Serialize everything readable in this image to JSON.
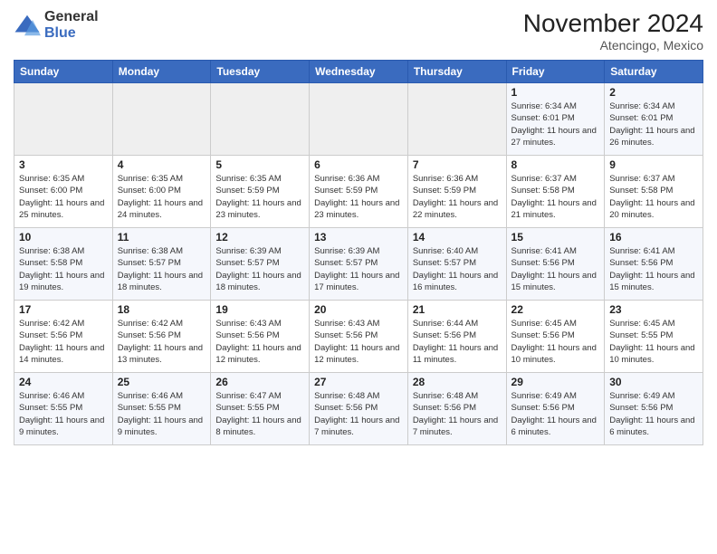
{
  "header": {
    "logo_general": "General",
    "logo_blue": "Blue",
    "month_title": "November 2024",
    "location": "Atencingo, Mexico"
  },
  "columns": [
    "Sunday",
    "Monday",
    "Tuesday",
    "Wednesday",
    "Thursday",
    "Friday",
    "Saturday"
  ],
  "weeks": [
    [
      {
        "day": "",
        "info": ""
      },
      {
        "day": "",
        "info": ""
      },
      {
        "day": "",
        "info": ""
      },
      {
        "day": "",
        "info": ""
      },
      {
        "day": "",
        "info": ""
      },
      {
        "day": "1",
        "info": "Sunrise: 6:34 AM\nSunset: 6:01 PM\nDaylight: 11 hours and 27 minutes."
      },
      {
        "day": "2",
        "info": "Sunrise: 6:34 AM\nSunset: 6:01 PM\nDaylight: 11 hours and 26 minutes."
      }
    ],
    [
      {
        "day": "3",
        "info": "Sunrise: 6:35 AM\nSunset: 6:00 PM\nDaylight: 11 hours and 25 minutes."
      },
      {
        "day": "4",
        "info": "Sunrise: 6:35 AM\nSunset: 6:00 PM\nDaylight: 11 hours and 24 minutes."
      },
      {
        "day": "5",
        "info": "Sunrise: 6:35 AM\nSunset: 5:59 PM\nDaylight: 11 hours and 23 minutes."
      },
      {
        "day": "6",
        "info": "Sunrise: 6:36 AM\nSunset: 5:59 PM\nDaylight: 11 hours and 23 minutes."
      },
      {
        "day": "7",
        "info": "Sunrise: 6:36 AM\nSunset: 5:59 PM\nDaylight: 11 hours and 22 minutes."
      },
      {
        "day": "8",
        "info": "Sunrise: 6:37 AM\nSunset: 5:58 PM\nDaylight: 11 hours and 21 minutes."
      },
      {
        "day": "9",
        "info": "Sunrise: 6:37 AM\nSunset: 5:58 PM\nDaylight: 11 hours and 20 minutes."
      }
    ],
    [
      {
        "day": "10",
        "info": "Sunrise: 6:38 AM\nSunset: 5:58 PM\nDaylight: 11 hours and 19 minutes."
      },
      {
        "day": "11",
        "info": "Sunrise: 6:38 AM\nSunset: 5:57 PM\nDaylight: 11 hours and 18 minutes."
      },
      {
        "day": "12",
        "info": "Sunrise: 6:39 AM\nSunset: 5:57 PM\nDaylight: 11 hours and 18 minutes."
      },
      {
        "day": "13",
        "info": "Sunrise: 6:39 AM\nSunset: 5:57 PM\nDaylight: 11 hours and 17 minutes."
      },
      {
        "day": "14",
        "info": "Sunrise: 6:40 AM\nSunset: 5:57 PM\nDaylight: 11 hours and 16 minutes."
      },
      {
        "day": "15",
        "info": "Sunrise: 6:41 AM\nSunset: 5:56 PM\nDaylight: 11 hours and 15 minutes."
      },
      {
        "day": "16",
        "info": "Sunrise: 6:41 AM\nSunset: 5:56 PM\nDaylight: 11 hours and 15 minutes."
      }
    ],
    [
      {
        "day": "17",
        "info": "Sunrise: 6:42 AM\nSunset: 5:56 PM\nDaylight: 11 hours and 14 minutes."
      },
      {
        "day": "18",
        "info": "Sunrise: 6:42 AM\nSunset: 5:56 PM\nDaylight: 11 hours and 13 minutes."
      },
      {
        "day": "19",
        "info": "Sunrise: 6:43 AM\nSunset: 5:56 PM\nDaylight: 11 hours and 12 minutes."
      },
      {
        "day": "20",
        "info": "Sunrise: 6:43 AM\nSunset: 5:56 PM\nDaylight: 11 hours and 12 minutes."
      },
      {
        "day": "21",
        "info": "Sunrise: 6:44 AM\nSunset: 5:56 PM\nDaylight: 11 hours and 11 minutes."
      },
      {
        "day": "22",
        "info": "Sunrise: 6:45 AM\nSunset: 5:56 PM\nDaylight: 11 hours and 10 minutes."
      },
      {
        "day": "23",
        "info": "Sunrise: 6:45 AM\nSunset: 5:55 PM\nDaylight: 11 hours and 10 minutes."
      }
    ],
    [
      {
        "day": "24",
        "info": "Sunrise: 6:46 AM\nSunset: 5:55 PM\nDaylight: 11 hours and 9 minutes."
      },
      {
        "day": "25",
        "info": "Sunrise: 6:46 AM\nSunset: 5:55 PM\nDaylight: 11 hours and 9 minutes."
      },
      {
        "day": "26",
        "info": "Sunrise: 6:47 AM\nSunset: 5:55 PM\nDaylight: 11 hours and 8 minutes."
      },
      {
        "day": "27",
        "info": "Sunrise: 6:48 AM\nSunset: 5:56 PM\nDaylight: 11 hours and 7 minutes."
      },
      {
        "day": "28",
        "info": "Sunrise: 6:48 AM\nSunset: 5:56 PM\nDaylight: 11 hours and 7 minutes."
      },
      {
        "day": "29",
        "info": "Sunrise: 6:49 AM\nSunset: 5:56 PM\nDaylight: 11 hours and 6 minutes."
      },
      {
        "day": "30",
        "info": "Sunrise: 6:49 AM\nSunset: 5:56 PM\nDaylight: 11 hours and 6 minutes."
      }
    ]
  ]
}
